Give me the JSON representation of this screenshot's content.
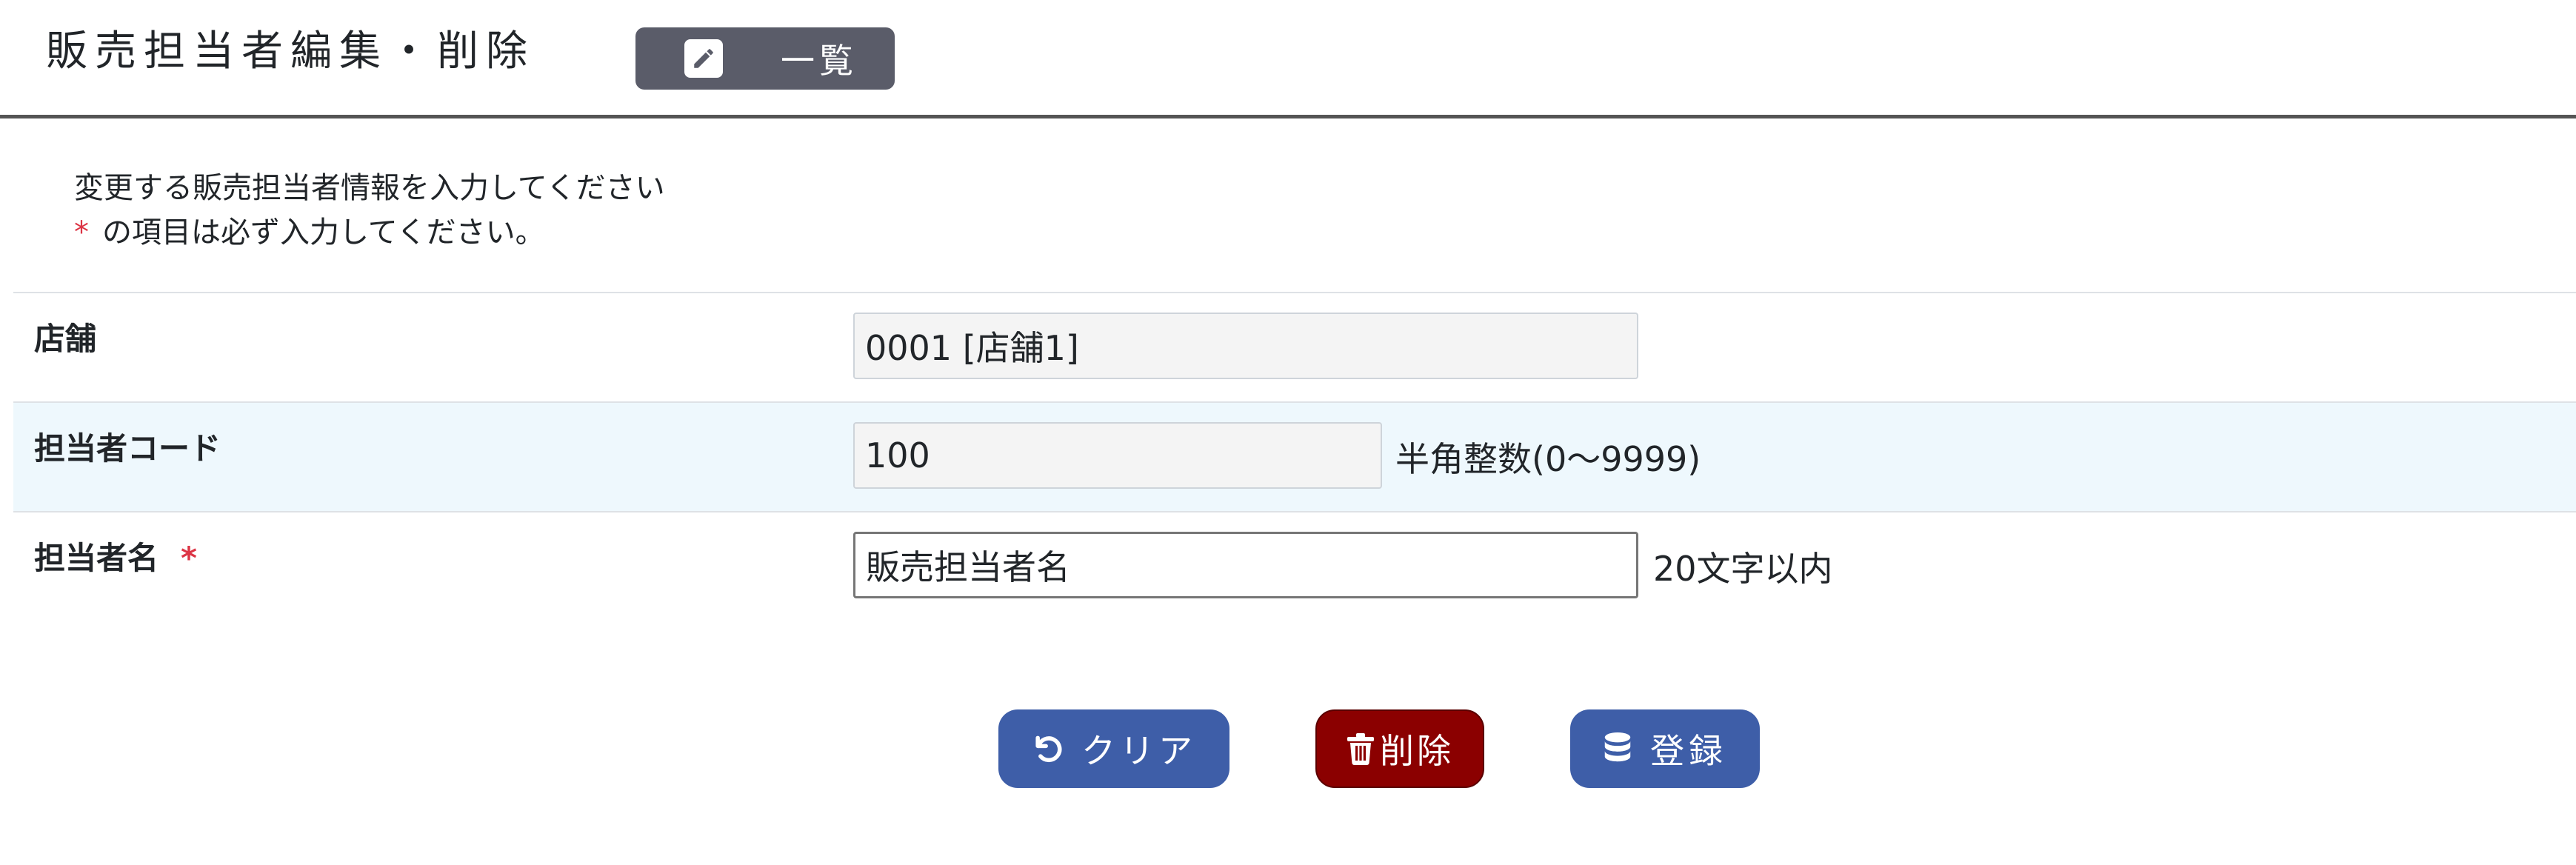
{
  "header": {
    "title": "販売担当者編集・削除",
    "list_button_label": "一覧"
  },
  "instructions": {
    "line1": "変更する販売担当者情報を入力してください",
    "required_mark": "*",
    "line2": "の項目は必ず入力してください。"
  },
  "form": {
    "store": {
      "label": "店舗",
      "value": "0001 [店舗1]"
    },
    "staff_code": {
      "label": "担当者コード",
      "value": "100",
      "hint": "半角整数(0～9999)"
    },
    "staff_name": {
      "label": "担当者名",
      "required_mark": "*",
      "value": "販売担当者名",
      "hint": "20文字以内"
    }
  },
  "actions": {
    "clear_label": "クリア",
    "delete_label": "削除",
    "register_label": "登録"
  },
  "icons": {
    "list_button": "pencil-icon",
    "clear": "undo-icon",
    "delete": "trash-icon",
    "register": "database-icon"
  },
  "colors": {
    "primary_button": "#3e5ea8",
    "danger_button": "#8b0000",
    "header_button": "#5a5c69",
    "required": "#dc3545",
    "alt_row": "#eef8fd"
  }
}
